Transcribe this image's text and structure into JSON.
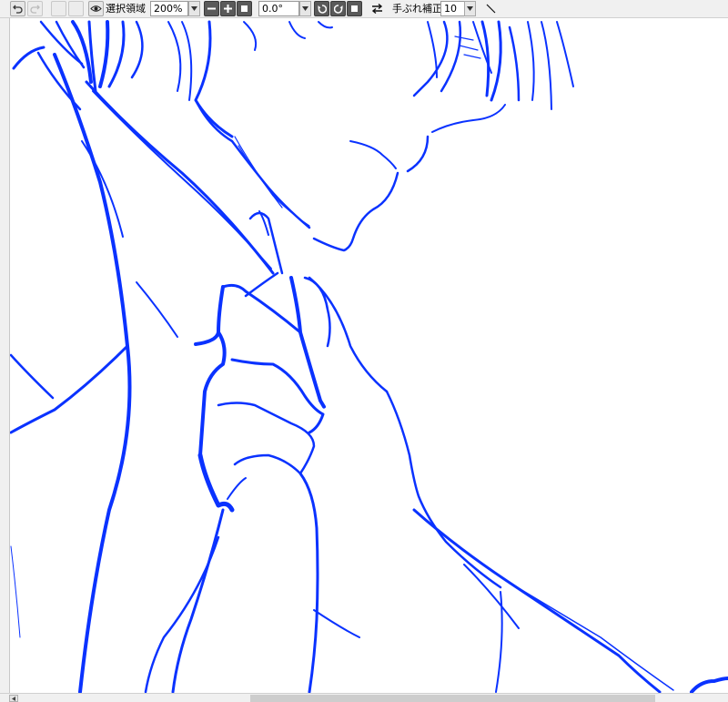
{
  "toolbar": {
    "zoom_value": "200%",
    "rotation_value": "0.0°",
    "selection_label": "選択領域",
    "stabilizer_label": "手ぶれ補正",
    "stabilizer_value": "10"
  },
  "icons": {
    "undo": "undo-icon",
    "redo": "redo-icon",
    "eye": "eye-icon",
    "flip": "flip-horizontal-icon",
    "pen_mode": "line-mode-icon"
  },
  "colors": {
    "stroke": "#0a32ff",
    "canvas": "#ffffff",
    "chrome": "#f0f0f0"
  }
}
